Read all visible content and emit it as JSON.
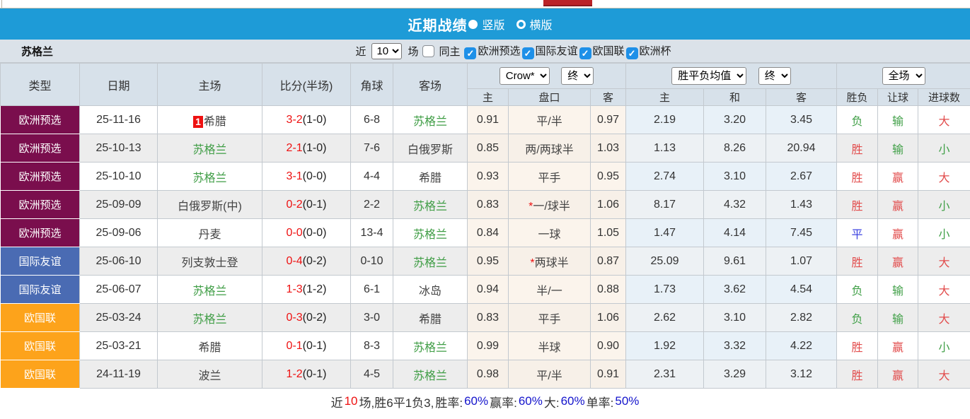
{
  "colors": {
    "titlebar_bg": "#1e9bd7",
    "header_bg": "#d7e1ea",
    "win_red": "#e24c4c",
    "lose_green": "#41a048",
    "draw_blue": "#3c43e0",
    "score_red": "#ee1111",
    "focus_team_green": "#3f9d45",
    "summary_blue": "#1414cc",
    "league_colors": {
      "欧洲预选": "#7a0e4d",
      "国际友谊": "#4a6bb3",
      "欧国联": "#fda31b"
    }
  },
  "titlebar": {
    "title": "近期战绩",
    "radio_vertical": "竖版",
    "radio_horizontal": "横版",
    "selected": "竖版"
  },
  "filter": {
    "team": "苏格兰",
    "recent_label": "近",
    "count_value": "10",
    "matches_label": "场",
    "same_home_label": "同主",
    "same_home_checked": false,
    "competitions": [
      {
        "label": "欧洲预选",
        "checked": true
      },
      {
        "label": "国际友谊",
        "checked": true
      },
      {
        "label": "欧国联",
        "checked": true
      },
      {
        "label": "欧洲杯",
        "checked": true
      }
    ]
  },
  "table": {
    "selects": {
      "crow": "Crow*",
      "crow_period": "终",
      "avg": "胜平负均值",
      "avg_period": "终",
      "scope": "全场"
    },
    "headers": {
      "main": [
        "类型",
        "日期",
        "主场",
        "比分(半场)",
        "角球",
        "客场"
      ],
      "sub": [
        "主",
        "盘口",
        "客",
        "主",
        "和",
        "客",
        "胜负",
        "让球",
        "进球数"
      ]
    },
    "rows": [
      {
        "league": "欧洲预选",
        "date": "25-11-16",
        "home": "希腊",
        "home_badge": "1",
        "home_focus": false,
        "score": "3-2",
        "half": "(1-0)",
        "corners": "6-8",
        "away": "苏格兰",
        "away_focus": true,
        "crow_home": "0.91",
        "handicap": "平/半",
        "star": false,
        "crow_away": "0.97",
        "avg_home": "2.19",
        "avg_draw": "3.20",
        "avg_away": "3.45",
        "result": "负",
        "spread": "输",
        "goals": "大"
      },
      {
        "league": "欧洲预选",
        "date": "25-10-13",
        "home": "苏格兰",
        "home_badge": "",
        "home_focus": true,
        "score": "2-1",
        "half": "(1-0)",
        "corners": "7-6",
        "away": "白俄罗斯",
        "away_focus": false,
        "crow_home": "0.85",
        "handicap": "两/两球半",
        "star": false,
        "crow_away": "1.03",
        "avg_home": "1.13",
        "avg_draw": "8.26",
        "avg_away": "20.94",
        "result": "胜",
        "spread": "输",
        "goals": "小"
      },
      {
        "league": "欧洲预选",
        "date": "25-10-10",
        "home": "苏格兰",
        "home_badge": "",
        "home_focus": true,
        "score": "3-1",
        "half": "(0-0)",
        "corners": "4-4",
        "away": "希腊",
        "away_focus": false,
        "crow_home": "0.93",
        "handicap": "平手",
        "star": false,
        "crow_away": "0.95",
        "avg_home": "2.74",
        "avg_draw": "3.10",
        "avg_away": "2.67",
        "result": "胜",
        "spread": "赢",
        "goals": "大"
      },
      {
        "league": "欧洲预选",
        "date": "25-09-09",
        "home": "白俄罗斯(中)",
        "home_badge": "",
        "home_focus": false,
        "score": "0-2",
        "half": "(0-1)",
        "corners": "2-2",
        "away": "苏格兰",
        "away_focus": true,
        "crow_home": "0.83",
        "handicap": "一/球半",
        "star": true,
        "crow_away": "1.06",
        "avg_home": "8.17",
        "avg_draw": "4.32",
        "avg_away": "1.43",
        "result": "胜",
        "spread": "赢",
        "goals": "小"
      },
      {
        "league": "欧洲预选",
        "date": "25-09-06",
        "home": "丹麦",
        "home_badge": "",
        "home_focus": false,
        "score": "0-0",
        "half": "(0-0)",
        "corners": "13-4",
        "away": "苏格兰",
        "away_focus": true,
        "crow_home": "0.84",
        "handicap": "一球",
        "star": false,
        "crow_away": "1.05",
        "avg_home": "1.47",
        "avg_draw": "4.14",
        "avg_away": "7.45",
        "result": "平",
        "spread": "赢",
        "goals": "小"
      },
      {
        "league": "国际友谊",
        "date": "25-06-10",
        "home": "列支敦士登",
        "home_badge": "",
        "home_focus": false,
        "score": "0-4",
        "half": "(0-2)",
        "corners": "0-10",
        "away": "苏格兰",
        "away_focus": true,
        "crow_home": "0.95",
        "handicap": "两球半",
        "star": true,
        "crow_away": "0.87",
        "avg_home": "25.09",
        "avg_draw": "9.61",
        "avg_away": "1.07",
        "result": "胜",
        "spread": "赢",
        "goals": "大"
      },
      {
        "league": "国际友谊",
        "date": "25-06-07",
        "home": "苏格兰",
        "home_badge": "",
        "home_focus": true,
        "score": "1-3",
        "half": "(1-2)",
        "corners": "6-1",
        "away": "冰岛",
        "away_focus": false,
        "crow_home": "0.94",
        "handicap": "半/一",
        "star": false,
        "crow_away": "0.88",
        "avg_home": "1.73",
        "avg_draw": "3.62",
        "avg_away": "4.54",
        "result": "负",
        "spread": "输",
        "goals": "大"
      },
      {
        "league": "欧国联",
        "date": "25-03-24",
        "home": "苏格兰",
        "home_badge": "",
        "home_focus": true,
        "score": "0-3",
        "half": "(0-2)",
        "corners": "3-0",
        "away": "希腊",
        "away_focus": false,
        "crow_home": "0.83",
        "handicap": "平手",
        "star": false,
        "crow_away": "1.06",
        "avg_home": "2.62",
        "avg_draw": "3.10",
        "avg_away": "2.82",
        "result": "负",
        "spread": "输",
        "goals": "大"
      },
      {
        "league": "欧国联",
        "date": "25-03-21",
        "home": "希腊",
        "home_badge": "",
        "home_focus": false,
        "score": "0-1",
        "half": "(0-1)",
        "corners": "8-3",
        "away": "苏格兰",
        "away_focus": true,
        "crow_home": "0.99",
        "handicap": "半球",
        "star": false,
        "crow_away": "0.90",
        "avg_home": "1.92",
        "avg_draw": "3.32",
        "avg_away": "4.22",
        "result": "胜",
        "spread": "赢",
        "goals": "小"
      },
      {
        "league": "欧国联",
        "date": "24-11-19",
        "home": "波兰",
        "home_badge": "",
        "home_focus": false,
        "score": "1-2",
        "half": "(0-1)",
        "corners": "4-5",
        "away": "苏格兰",
        "away_focus": true,
        "crow_home": "0.98",
        "handicap": "平/半",
        "star": false,
        "crow_away": "0.91",
        "avg_home": "2.31",
        "avg_draw": "3.29",
        "avg_away": "3.12",
        "result": "胜",
        "spread": "赢",
        "goals": "大"
      }
    ]
  },
  "summary": {
    "segments": [
      {
        "text": "近",
        "color": "#333333"
      },
      {
        "text": "10",
        "color": "#ee1111"
      },
      {
        "text": "场,胜6平1负3, ",
        "color": "#333333"
      },
      {
        "text": "胜率:",
        "color": "#333333"
      },
      {
        "text": "60%",
        "color": "#1414cc"
      },
      {
        "text": " 赢率:",
        "color": "#333333"
      },
      {
        "text": "60%",
        "color": "#1414cc"
      },
      {
        "text": " 大:",
        "color": "#333333"
      },
      {
        "text": "60%",
        "color": "#1414cc"
      },
      {
        "text": " 单率:",
        "color": "#333333"
      },
      {
        "text": "50%",
        "color": "#1414cc"
      }
    ]
  }
}
